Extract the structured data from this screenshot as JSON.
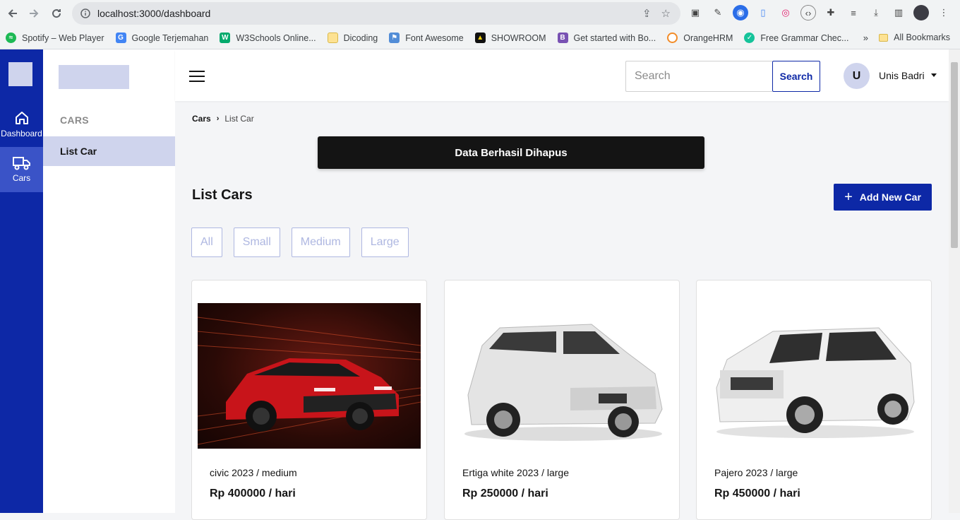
{
  "browser": {
    "url": "localhost:3000/dashboard",
    "bookmarks": [
      {
        "label": "Spotify – Web Player",
        "icon": "spotify-icon",
        "color": "#1db954"
      },
      {
        "label": "Google Terjemahan",
        "icon": "translate-icon",
        "color": "#4285f4"
      },
      {
        "label": "W3Schools Online...",
        "icon": "w3schools-icon",
        "color": "#04aa6d"
      },
      {
        "label": "Dicoding",
        "icon": "folder-icon",
        "color": "#fde293"
      },
      {
        "label": "Font Awesome",
        "icon": "flag-icon",
        "color": "#528dd7"
      },
      {
        "label": "SHOWROOM",
        "icon": "showroom-icon",
        "color": "#111111"
      },
      {
        "label": "Get started with Bo...",
        "icon": "bootstrap-icon",
        "color": "#7952b3"
      },
      {
        "label": "OrangeHRM",
        "icon": "orangehrm-icon",
        "color": "#f28c28"
      },
      {
        "label": "Free Grammar Chec...",
        "icon": "grammar-icon",
        "color": "#15c39a"
      }
    ],
    "all_bookmarks_label": "All Bookmarks",
    "more_label": "»"
  },
  "rail": {
    "items": [
      {
        "label": "Dashboard",
        "icon": "home-icon"
      },
      {
        "label": "Cars",
        "icon": "truck-icon"
      }
    ]
  },
  "subnav": {
    "section_title": "CARS",
    "items": [
      {
        "label": "List Car"
      }
    ]
  },
  "topbar": {
    "search_placeholder": "Search",
    "search_button": "Search",
    "avatar_initial": "U",
    "user_name": "Unis Badri"
  },
  "main": {
    "breadcrumb": {
      "root": "Cars",
      "current": "List Car"
    },
    "toast": "Data Berhasil Dihapus",
    "title": "List Cars",
    "add_button": "Add New Car",
    "filters": [
      "All",
      "Small",
      "Medium",
      "Large"
    ],
    "cars": [
      {
        "name": "civic 2023 / medium",
        "price": "Rp 400000 / hari",
        "color": "#d8161e"
      },
      {
        "name": "Ertiga white 2023 / large",
        "price": "Rp 250000 / hari",
        "color": "#e9e9e9"
      },
      {
        "name": "Pajero 2023 / large",
        "price": "Rp 450000 / hari",
        "color": "#f0f0f0"
      }
    ]
  },
  "colors": {
    "primary": "#0d28a6",
    "primary_light": "#cfd4ed",
    "toast_bg": "#141414"
  }
}
